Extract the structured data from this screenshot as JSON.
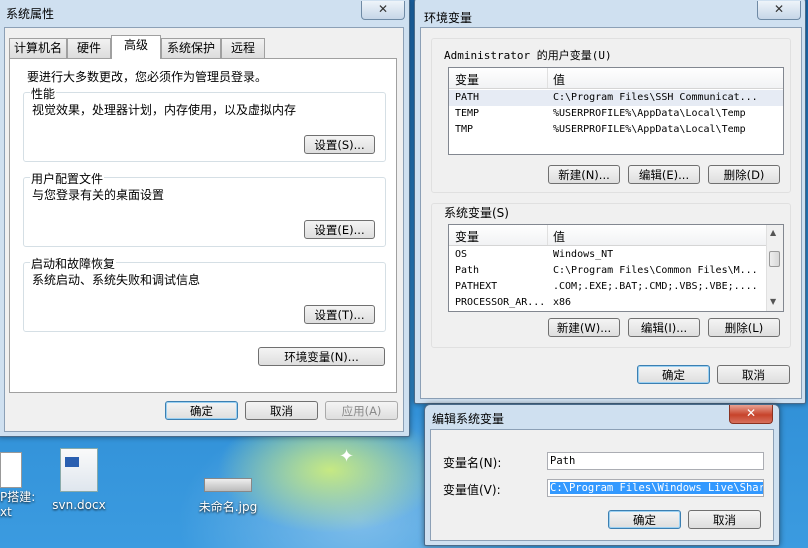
{
  "desktop": {
    "icons": [
      {
        "label_line1": "P搭建:",
        "label_line2": "xt"
      },
      {
        "label_line1": "svn.docx"
      },
      {
        "label_line1": "未命名.jpg"
      }
    ]
  },
  "sysprops": {
    "title": "系统属性",
    "tabs": [
      "计算机名",
      "硬件",
      "高级",
      "系统保护",
      "远程"
    ],
    "admin_note": "要进行大多数更改，您必须作为管理员登录。",
    "performance": {
      "legend": "性能",
      "desc": "视觉效果，处理器计划，内存使用，以及虚拟内存",
      "button": "设置(S)..."
    },
    "profiles": {
      "legend": "用户配置文件",
      "desc": "与您登录有关的桌面设置",
      "button": "设置(E)..."
    },
    "startup": {
      "legend": "启动和故障恢复",
      "desc": "系统启动、系统失败和调试信息",
      "button": "设置(T)..."
    },
    "env_button": "环境变量(N)...",
    "ok": "确定",
    "cancel": "取消",
    "apply": "应用(A)"
  },
  "envvars": {
    "title": "环境变量",
    "user_section": "Administrator 的用户变量(U)",
    "col_var": "变量",
    "col_val": "值",
    "user_vars": [
      {
        "name": "PATH",
        "value": "C:\\Program Files\\SSH Communicat..."
      },
      {
        "name": "TEMP",
        "value": "%USERPROFILE%\\AppData\\Local\\Temp"
      },
      {
        "name": "TMP",
        "value": "%USERPROFILE%\\AppData\\Local\\Temp"
      }
    ],
    "user_new": "新建(N)...",
    "user_edit": "编辑(E)...",
    "user_delete": "删除(D)",
    "sys_section": "系统变量(S)",
    "sys_vars": [
      {
        "name": "OS",
        "value": "Windows_NT"
      },
      {
        "name": "Path",
        "value": "C:\\Program Files\\Common Files\\M..."
      },
      {
        "name": "PATHEXT",
        "value": ".COM;.EXE;.BAT;.CMD;.VBS;.VBE;...."
      },
      {
        "name": "PROCESSOR_AR...",
        "value": "x86"
      }
    ],
    "sys_new": "新建(W)...",
    "sys_edit": "编辑(I)...",
    "sys_delete": "删除(L)",
    "ok": "确定",
    "cancel": "取消"
  },
  "editvar": {
    "title": "编辑系统变量",
    "name_label": "变量名(N):",
    "name_value": "Path",
    "value_label": "变量值(V):",
    "value_value": "C:\\Program Files\\Windows Live\\Shared",
    "ok": "确定",
    "cancel": "取消"
  }
}
